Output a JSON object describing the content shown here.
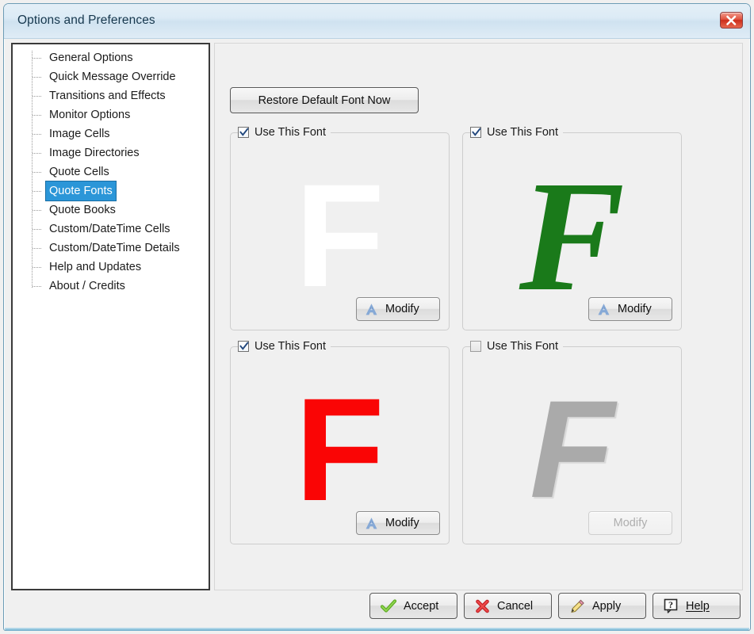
{
  "window": {
    "title": "Options and Preferences",
    "close_icon": "close-icon"
  },
  "sidebar": {
    "items": [
      {
        "label": "General Options",
        "selected": false
      },
      {
        "label": "Quick Message Override",
        "selected": false
      },
      {
        "label": "Transitions and Effects",
        "selected": false
      },
      {
        "label": "Monitor Options",
        "selected": false
      },
      {
        "label": "Image Cells",
        "selected": false
      },
      {
        "label": "Image Directories",
        "selected": false
      },
      {
        "label": "Quote Cells",
        "selected": false
      },
      {
        "label": "Quote Fonts",
        "selected": true
      },
      {
        "label": "Quote Books",
        "selected": false
      },
      {
        "label": "Custom/DateTime Cells",
        "selected": false
      },
      {
        "label": "Custom/DateTime Details",
        "selected": false
      },
      {
        "label": "Help and Updates",
        "selected": false
      },
      {
        "label": "About / Credits",
        "selected": false
      }
    ]
  },
  "main": {
    "restore_button": "Restore Default Font Now",
    "font_slots": [
      {
        "checkbox_label": "Use This Font",
        "checked": true,
        "enabled": true,
        "modify_label": "Modify",
        "modify_icon": "font-a-icon",
        "sample_char": "F",
        "sample_color": "#ffffff",
        "sample_style": "sans-bold",
        "sample_size_px": 185
      },
      {
        "checkbox_label": "Use This Font",
        "checked": true,
        "enabled": true,
        "modify_label": "Modify",
        "modify_icon": "font-a-icon",
        "sample_char": "F",
        "sample_color": "#1a7a1a",
        "sample_style": "serif-bold-italic",
        "sample_size_px": 200
      },
      {
        "checkbox_label": "Use This Font",
        "checked": true,
        "enabled": true,
        "modify_label": "Modify",
        "modify_icon": "font-a-icon",
        "sample_char": "F",
        "sample_color": "#fa0505",
        "sample_style": "sans-bold",
        "sample_size_px": 185
      },
      {
        "checkbox_label": "Use This Font",
        "checked": false,
        "enabled": false,
        "modify_label": "Modify",
        "modify_icon": "none",
        "sample_char": "F",
        "sample_color": "#aaaaaa",
        "sample_style": "sans-bold-italic",
        "sample_size_px": 175
      }
    ]
  },
  "footer": {
    "accept": {
      "label": "Accept",
      "icon": "check-icon"
    },
    "cancel": {
      "label": "Cancel",
      "icon": "x-icon"
    },
    "apply": {
      "label": "Apply",
      "icon": "pencil-icon"
    },
    "help": {
      "label": "Help",
      "icon": "question-balloon-icon"
    }
  },
  "colors": {
    "selection": "#2b96d8",
    "title_text": "#16374d",
    "panel_bg": "#f0f0f0",
    "tree_bg": "#ffffff"
  }
}
